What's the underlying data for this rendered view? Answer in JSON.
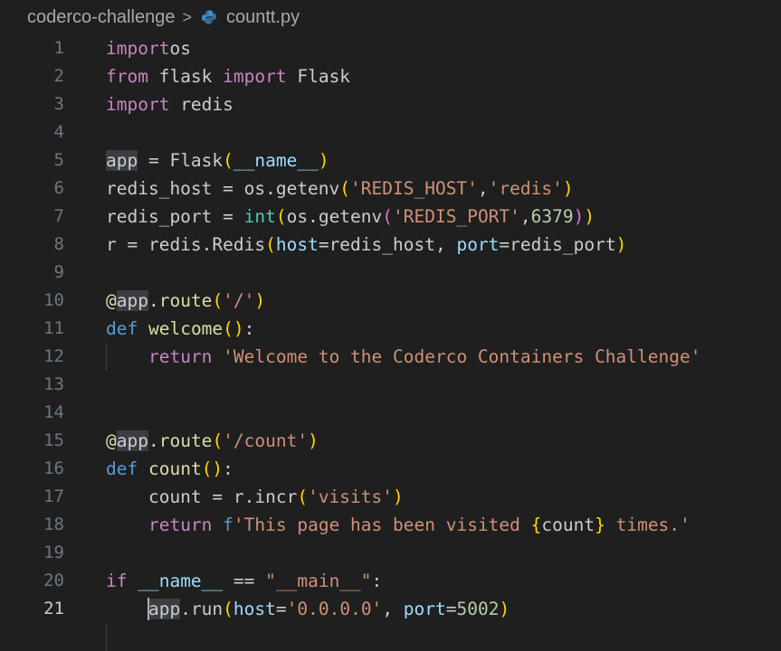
{
  "breadcrumb": {
    "folder": "coderco-challenge",
    "separator": ">",
    "file": "countt.py",
    "file_icon": "python-icon"
  },
  "editor": {
    "current_line": 21,
    "lines": [
      {
        "n": "1",
        "t": [
          [
            "kw",
            "import"
          ],
          [
            "",
            "os"
          ]
        ]
      },
      {
        "n": "2",
        "t": [
          [
            "kw",
            "from"
          ],
          [
            "",
            " flask "
          ],
          [
            "kw",
            "import"
          ],
          [
            "",
            " Flask"
          ]
        ]
      },
      {
        "n": "3",
        "t": [
          [
            "kw",
            "import"
          ],
          [
            "",
            " redis"
          ]
        ]
      },
      {
        "n": "4",
        "t": []
      },
      {
        "n": "5",
        "t": [
          [
            "hl",
            "app"
          ],
          [
            "",
            " = Flask"
          ],
          [
            "p1",
            "("
          ],
          [
            "var",
            "__name__"
          ],
          [
            "p1",
            ")"
          ]
        ]
      },
      {
        "n": "6",
        "t": [
          [
            "",
            "redis_host = os.getenv"
          ],
          [
            "p1",
            "("
          ],
          [
            "str",
            "'REDIS_HOST'"
          ],
          [
            "",
            ","
          ],
          [
            "str",
            "'redis'"
          ],
          [
            "p1",
            ")"
          ]
        ]
      },
      {
        "n": "7",
        "t": [
          [
            "",
            "redis_port = "
          ],
          [
            "bi",
            "int"
          ],
          [
            "p1",
            "("
          ],
          [
            "",
            "os.getenv"
          ],
          [
            "p2",
            "("
          ],
          [
            "str",
            "'REDIS_PORT'"
          ],
          [
            "",
            ","
          ],
          [
            "num",
            "6379"
          ],
          [
            "p2",
            ")"
          ],
          [
            "p1",
            ")"
          ]
        ]
      },
      {
        "n": "8",
        "t": [
          [
            "",
            "r = redis.Redis"
          ],
          [
            "p1",
            "("
          ],
          [
            "var",
            "host"
          ],
          [
            "",
            "=redis_host, "
          ],
          [
            "var",
            "port"
          ],
          [
            "",
            "=redis_port"
          ],
          [
            "p1",
            ")"
          ]
        ]
      },
      {
        "n": "9",
        "t": []
      },
      {
        "n": "10",
        "t": [
          [
            "fn",
            "@"
          ],
          [
            "hl",
            "app"
          ],
          [
            "fn",
            ".route"
          ],
          [
            "p1",
            "("
          ],
          [
            "str",
            "'/'"
          ],
          [
            "p1",
            ")"
          ]
        ]
      },
      {
        "n": "11",
        "t": [
          [
            "def",
            "def"
          ],
          [
            "",
            " "
          ],
          [
            "fn",
            "welcome"
          ],
          [
            "p1",
            "()"
          ],
          [
            "",
            ":"
          ]
        ]
      },
      {
        "n": "12",
        "t": [
          [
            "",
            "    "
          ],
          [
            "kw",
            "return"
          ],
          [
            "",
            " "
          ],
          [
            "str",
            "'Welcome to the Coderco Containers Challenge'"
          ]
        ]
      },
      {
        "n": "13",
        "t": []
      },
      {
        "n": "14",
        "t": []
      },
      {
        "n": "15",
        "t": [
          [
            "fn",
            "@"
          ],
          [
            "hl",
            "app"
          ],
          [
            "fn",
            ".route"
          ],
          [
            "p1",
            "("
          ],
          [
            "str",
            "'/count'"
          ],
          [
            "p1",
            ")"
          ]
        ]
      },
      {
        "n": "16",
        "t": [
          [
            "def",
            "def"
          ],
          [
            "",
            " "
          ],
          [
            "fn",
            "count"
          ],
          [
            "p1",
            "()"
          ],
          [
            "",
            ":"
          ]
        ]
      },
      {
        "n": "17",
        "t": [
          [
            "",
            "    count = r.incr"
          ],
          [
            "p1",
            "("
          ],
          [
            "str",
            "'visits'"
          ],
          [
            "p1",
            ")"
          ]
        ]
      },
      {
        "n": "18",
        "t": [
          [
            "",
            "    "
          ],
          [
            "kw",
            "return"
          ],
          [
            "",
            " "
          ],
          [
            "def",
            "f"
          ],
          [
            "str",
            "'This page has been visited "
          ],
          [
            "p1",
            "{"
          ],
          [
            "",
            "count"
          ],
          [
            "p1",
            "}"
          ],
          [
            "str",
            " times.'"
          ]
        ]
      },
      {
        "n": "19",
        "t": []
      },
      {
        "n": "20",
        "t": [
          [
            "kw",
            "if"
          ],
          [
            "",
            " "
          ],
          [
            "var",
            "__name__"
          ],
          [
            "",
            " == "
          ],
          [
            "str",
            "\"__main__\""
          ],
          [
            "",
            ":"
          ]
        ]
      },
      {
        "n": "21",
        "t": [
          [
            "",
            "    "
          ],
          [
            "hl",
            "app"
          ],
          [
            "",
            ".run"
          ],
          [
            "p1",
            "("
          ],
          [
            "var",
            "host"
          ],
          [
            "",
            "="
          ],
          [
            "str",
            "'0.0.0.0'"
          ],
          [
            "",
            ", "
          ],
          [
            "var",
            "port"
          ],
          [
            "",
            "="
          ],
          [
            "num",
            "5002"
          ],
          [
            "p1",
            ")"
          ]
        ]
      }
    ]
  }
}
